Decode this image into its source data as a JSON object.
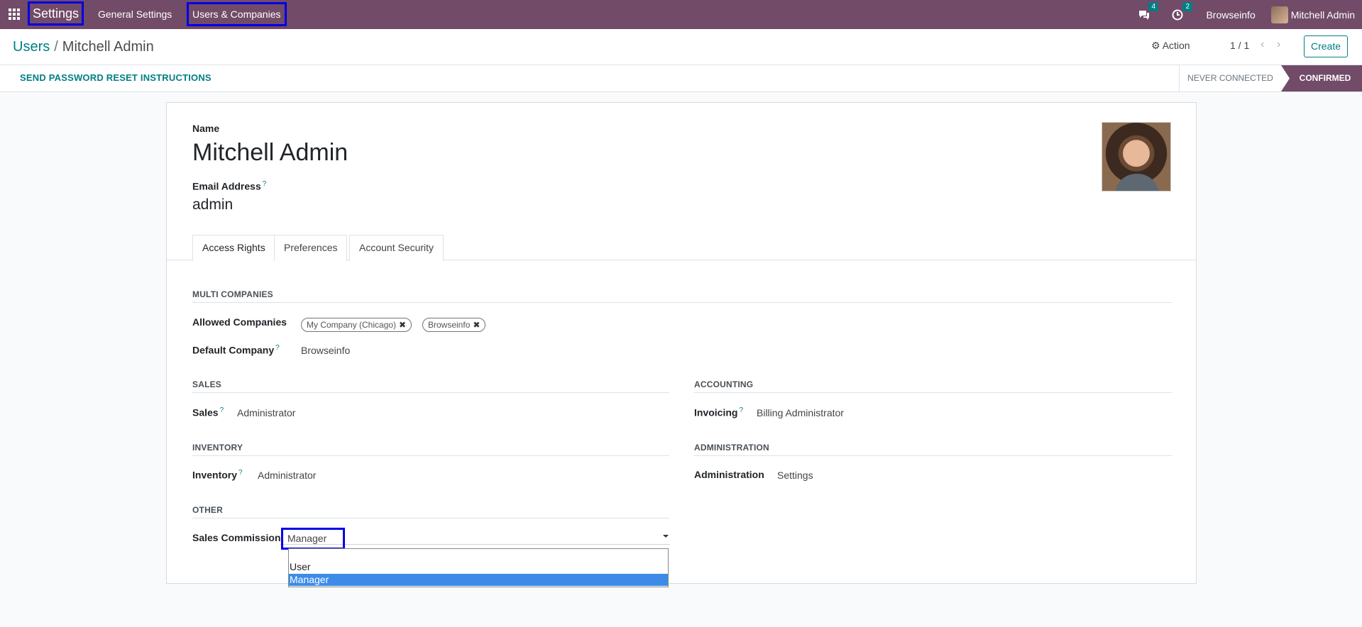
{
  "navbar": {
    "brand": "Settings",
    "menus": [
      "General Settings",
      "Users & Companies"
    ],
    "messages_count": "4",
    "activities_count": "2",
    "company": "Browseinfo",
    "user": "Mitchell Admin"
  },
  "control_panel": {
    "breadcrumb_parent": "Users",
    "breadcrumb_separator": "/",
    "breadcrumb_current": "Mitchell Admin",
    "action_label": "Action",
    "pager": "1 / 1",
    "create_label": "Create"
  },
  "statusbar": {
    "reset_button": "SEND PASSWORD RESET INSTRUCTIONS",
    "states": [
      "NEVER CONNECTED",
      "CONFIRMED"
    ],
    "active_state": "CONFIRMED"
  },
  "form": {
    "name_label": "Name",
    "name": "Mitchell Admin",
    "email_label": "Email Address",
    "email": "admin",
    "help_mark": "?",
    "tabs": [
      "Access Rights",
      "Preferences",
      "Account Security"
    ],
    "active_tab": "Access Rights",
    "multi_companies": {
      "title": "MULTI COMPANIES",
      "allowed_label": "Allowed Companies",
      "allowed": [
        "My Company (Chicago)",
        "Browseinfo"
      ],
      "default_label": "Default Company",
      "default": "Browseinfo"
    },
    "sales": {
      "title": "SALES",
      "label": "Sales",
      "value": "Administrator"
    },
    "accounting": {
      "title": "ACCOUNTING",
      "label": "Invoicing",
      "value": "Billing Administrator"
    },
    "inventory": {
      "title": "INVENTORY",
      "label": "Inventory",
      "value": "Administrator"
    },
    "administration": {
      "title": "ADMINISTRATION",
      "label": "Administration",
      "value": "Settings"
    },
    "other": {
      "title": "OTHER",
      "label": "Sales Commission",
      "value": "Manager",
      "options": [
        "",
        "User",
        "Manager"
      ],
      "highlighted": "Manager"
    }
  },
  "colors": {
    "navbar": "#714b67",
    "accent": "#017e84",
    "highlight_outline": "#0000e6",
    "option_selected": "#3c8ce7"
  }
}
